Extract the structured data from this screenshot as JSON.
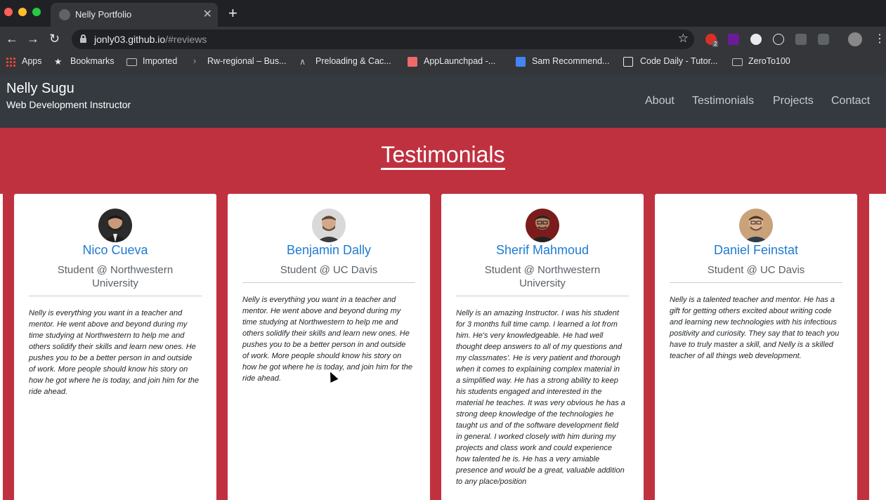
{
  "browser": {
    "tab_title": "Nelly Portfolio",
    "url_host": "jonly03.github.io",
    "url_path": "/#reviews",
    "extension_badge": "2",
    "bookmarks": [
      {
        "label": "Apps"
      },
      {
        "label": "Bookmarks"
      },
      {
        "label": "Imported"
      },
      {
        "label": "Rw-regional – Bus..."
      },
      {
        "label": "Preloading & Cac..."
      },
      {
        "label": "AppLaunchpad -..."
      },
      {
        "label": "Sam Recommend..."
      },
      {
        "label": "Code Daily - Tutor..."
      },
      {
        "label": "ZeroTo100"
      }
    ]
  },
  "site": {
    "brand_name": "Nelly Sugu",
    "brand_subtitle": "Web Development Instructor",
    "nav": [
      {
        "label": "About"
      },
      {
        "label": "Testimonials"
      },
      {
        "label": "Projects"
      },
      {
        "label": "Contact"
      }
    ]
  },
  "testimonials": {
    "title": "Testimonials",
    "cards": [
      {
        "name": "Nico Cueva",
        "role": "Student @ Northwestern University",
        "quote": "Nelly is everything you want in a teacher and mentor. He went above and beyond during my time studying at Northwestern to help me and others solidify their skills and learn new ones. He pushes you to be a better person in and outside of work. More people should know his story on how he got where he is today, and join him for the ride ahead."
      },
      {
        "name": "Benjamin Dally",
        "role": "Student @ UC Davis",
        "quote": "Nelly is everything you want in a teacher and mentor. He went above and beyond during my time studying at Northwestern to help me and others solidify their skills and learn new ones. He pushes you to be a better person in and outside of work. More people should know his story on how he got where he is today, and join him for the ride ahead."
      },
      {
        "name": "Sherif Mahmoud",
        "role": "Student @ Northwestern University",
        "quote": "Nelly is an amazing Instructor. I was his student for 3 months full time camp. I learned a lot from him. He's very knowledgeable. He had well thought deep answers to all of my questions and my classmates'. He is very patient and thorough when it comes to explaining complex material in a simplified way. He has a strong ability to keep his students engaged and interested in the material he teaches. It was very obvious he has a strong deep knowledge of the technologies he taught us and of the software development field in general. I worked closely with him during my projects and class work and could experience how talented he is. He has a very amiable presence and would be a great, valuable addition to any place/position"
      },
      {
        "name": "Daniel Feinstat",
        "role": "Student @ UC Davis",
        "quote": "Nelly is a talented teacher and mentor. He has a gift for getting others excited about writing code and learning new technologies with his infectious positivity and curiosity. They say that to teach you have to truly master a skill, and Nelly is a skilled teacher of all things web development."
      }
    ]
  },
  "colors": {
    "section_bg": "#c0313f",
    "header_bg": "#343a40",
    "name_blue": "#1e7bd2"
  }
}
